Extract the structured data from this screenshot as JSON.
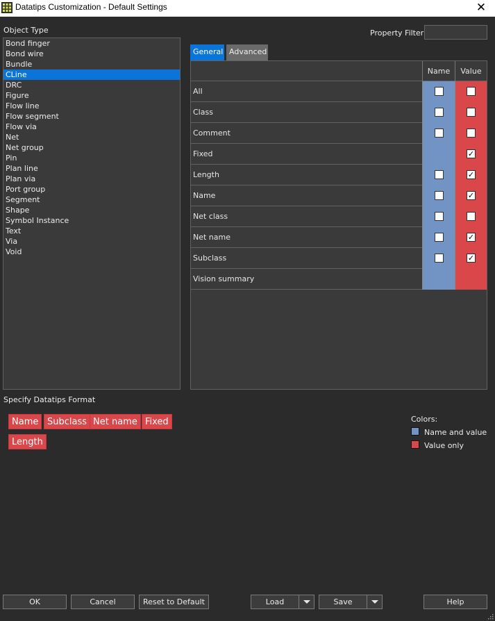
{
  "window": {
    "title": "Datatips Customization - Default Settings",
    "close_glyph": "✕",
    "icon": "grid-app-icon"
  },
  "object_type": {
    "label": "Object Type",
    "items": [
      "Bond finger",
      "Bond wire",
      "Bundle",
      "CLine",
      "DRC",
      "Figure",
      "Flow line",
      "Flow segment",
      "Flow via",
      "Net",
      "Net group",
      "Pin",
      "Plan line",
      "Plan via",
      "Port group",
      "Segment",
      "Shape",
      "Symbol Instance",
      "Text",
      "Via",
      "Void"
    ],
    "selected": "CLine"
  },
  "property_filter": {
    "label": "Property Filter",
    "value": ""
  },
  "tabs": [
    {
      "label": "General",
      "active": true
    },
    {
      "label": "Advanced",
      "active": false
    }
  ],
  "grid": {
    "col_name": "Name",
    "col_value": "Value",
    "rows": [
      {
        "label": "All",
        "name_cb": true,
        "name_checked": false,
        "value_cb": true,
        "value_checked": false
      },
      {
        "label": "Class",
        "name_cb": true,
        "name_checked": false,
        "value_cb": true,
        "value_checked": false
      },
      {
        "label": "Comment",
        "name_cb": true,
        "name_checked": false,
        "value_cb": true,
        "value_checked": false
      },
      {
        "label": "Fixed",
        "name_cb": false,
        "name_checked": false,
        "value_cb": true,
        "value_checked": true
      },
      {
        "label": "Length",
        "name_cb": true,
        "name_checked": false,
        "value_cb": true,
        "value_checked": true
      },
      {
        "label": "Name",
        "name_cb": true,
        "name_checked": false,
        "value_cb": true,
        "value_checked": true
      },
      {
        "label": "Net class",
        "name_cb": true,
        "name_checked": false,
        "value_cb": true,
        "value_checked": false
      },
      {
        "label": "Net name",
        "name_cb": true,
        "name_checked": false,
        "value_cb": true,
        "value_checked": true
      },
      {
        "label": "Subclass",
        "name_cb": true,
        "name_checked": false,
        "value_cb": true,
        "value_checked": true
      },
      {
        "label": "Vision summary",
        "name_cb": false,
        "name_checked": false,
        "value_cb": false,
        "value_checked": false
      }
    ]
  },
  "format": {
    "label": "Specify Datatips Format",
    "chips": [
      "Name",
      "Subclass",
      "Net name",
      "Fixed",
      "Length"
    ]
  },
  "legend": {
    "title": "Colors:",
    "items": [
      {
        "label": "Name and value",
        "color": "#7294c4"
      },
      {
        "label": "Value only",
        "color": "#d9474b"
      }
    ]
  },
  "buttons": {
    "ok": "OK",
    "cancel": "Cancel",
    "reset": "Reset to Default",
    "load": "Load",
    "save": "Save",
    "help": "Help"
  },
  "colors": {
    "accent": "#0a74d8",
    "name_col": "#7294c4",
    "value_col": "#d9474b",
    "background": "#2b2b2b"
  }
}
